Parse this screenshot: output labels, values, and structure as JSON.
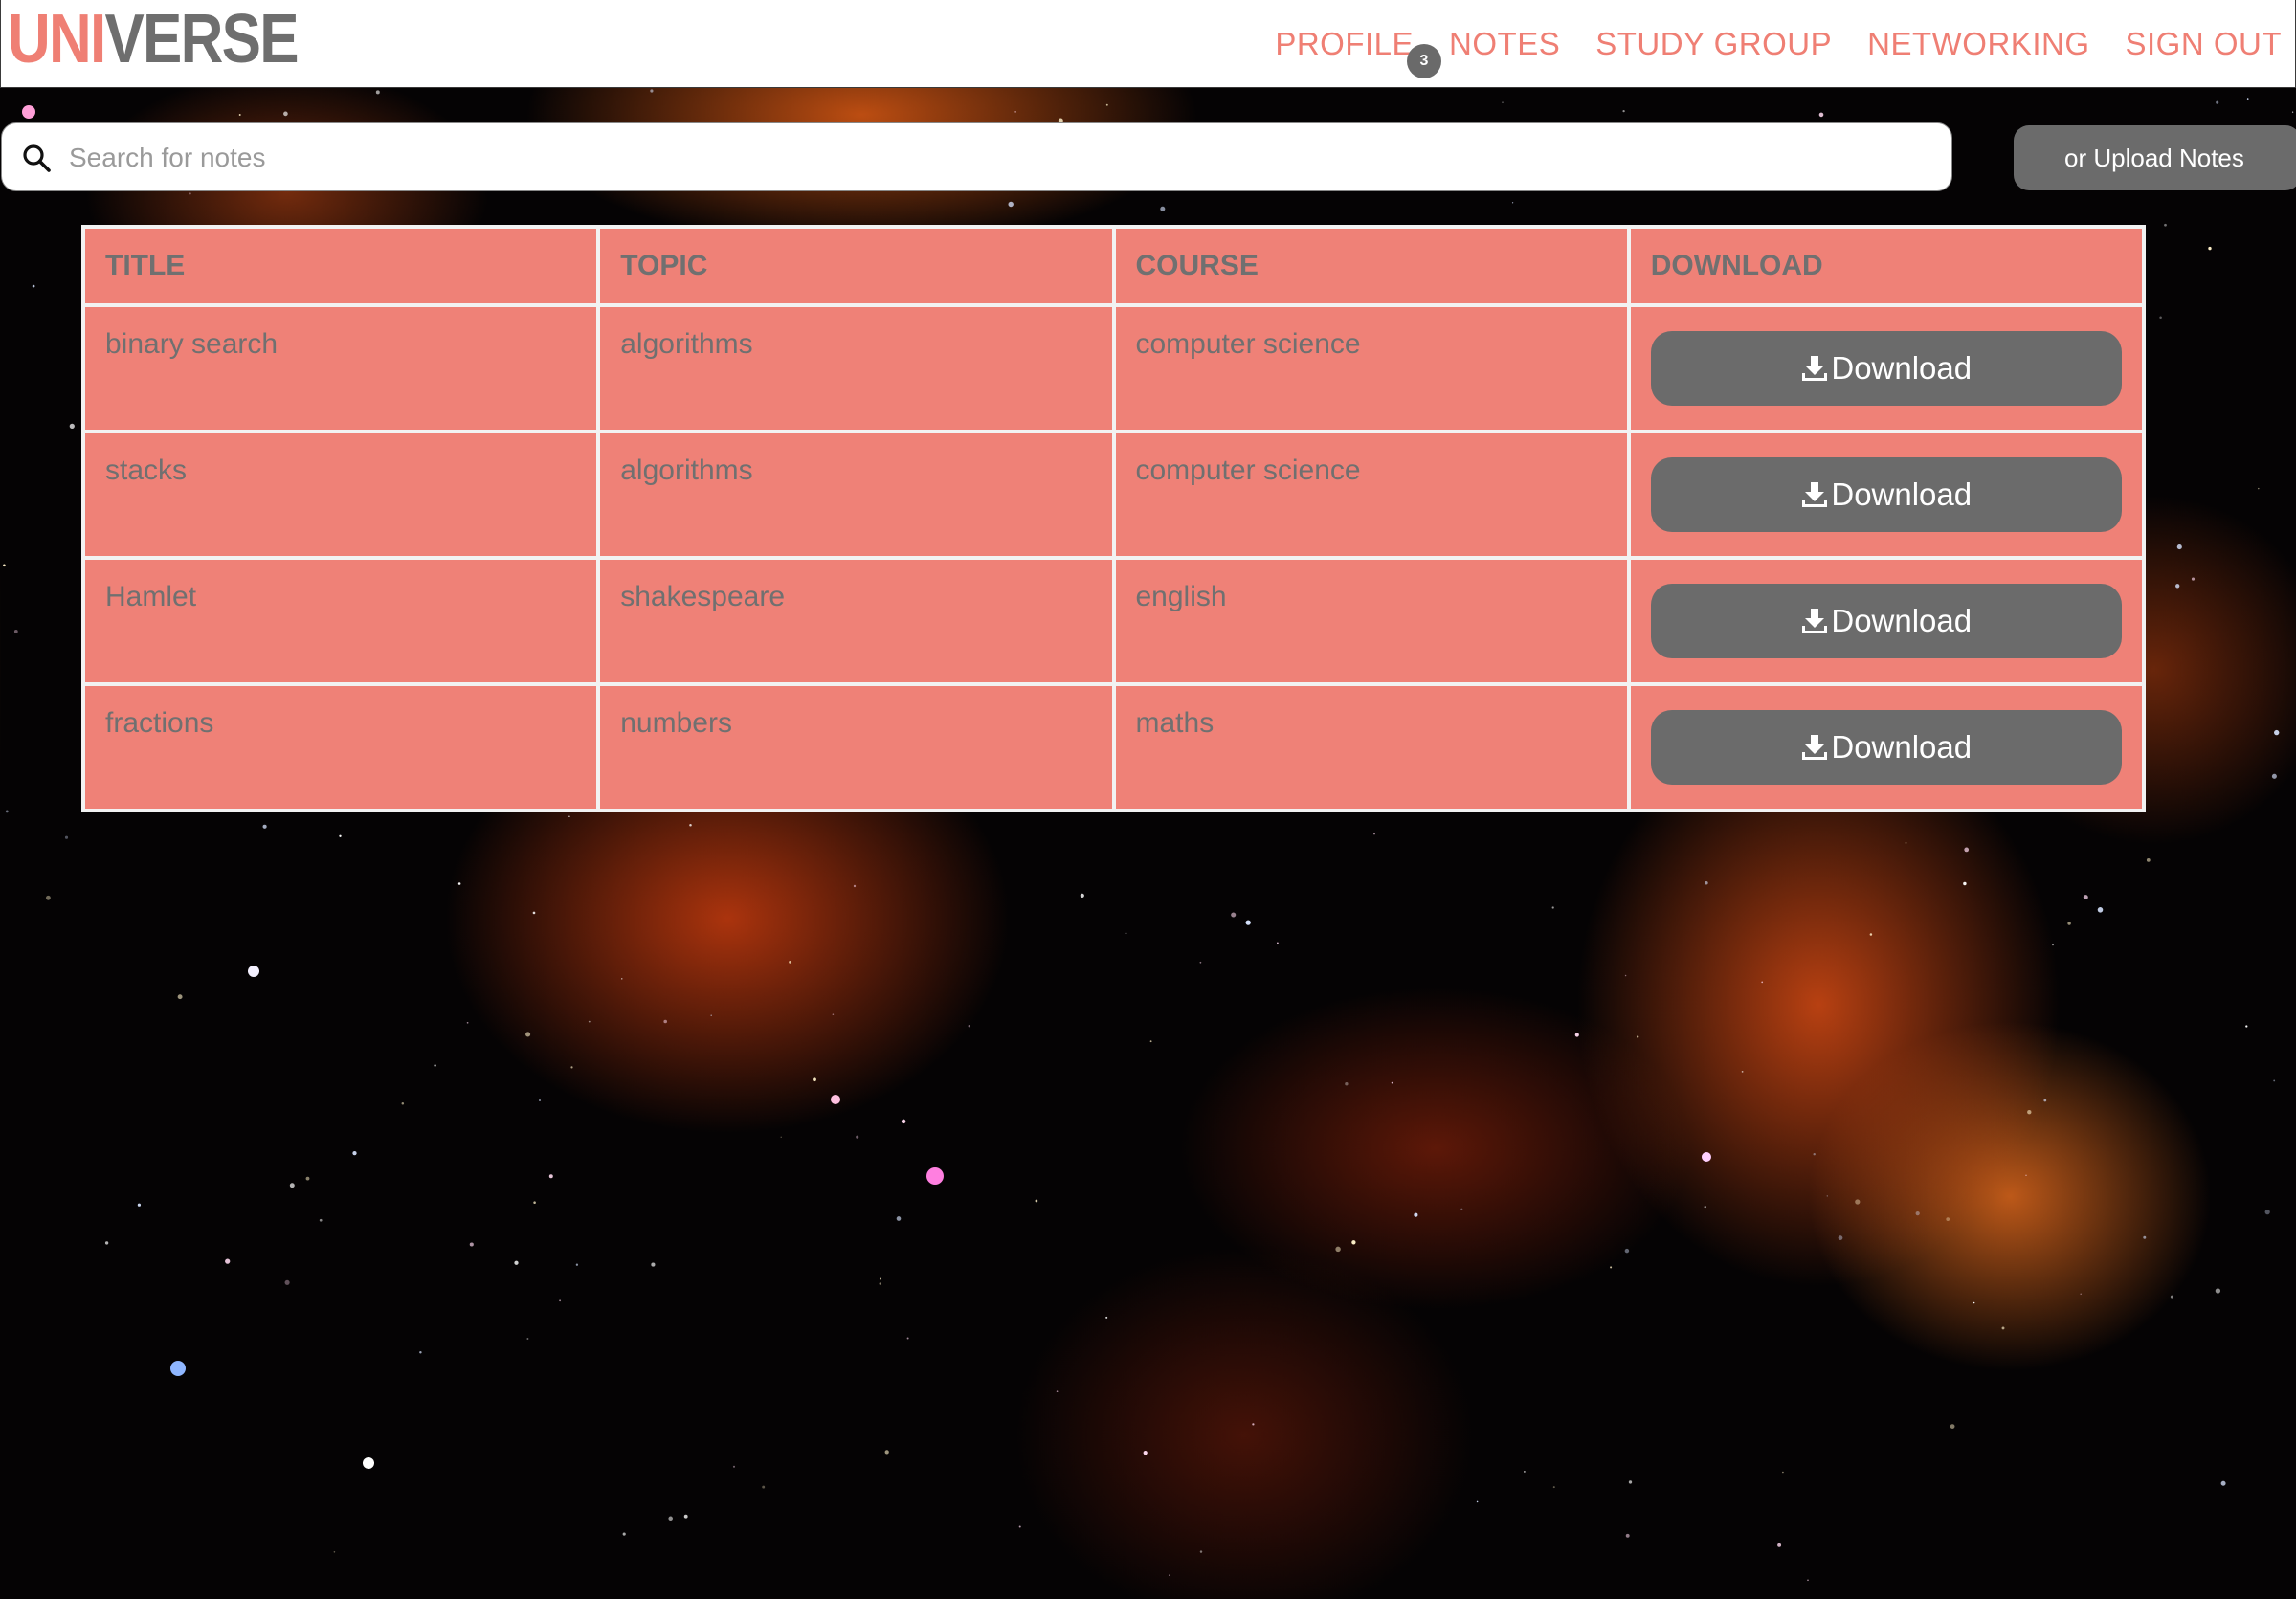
{
  "brand": {
    "part1": "UNI",
    "part2": "VERSE"
  },
  "nav": {
    "items": [
      {
        "id": "profile",
        "label": "PROFILE"
      },
      {
        "id": "notes",
        "label": "NOTES"
      },
      {
        "id": "study_group",
        "label": "STUDY GROUP"
      },
      {
        "id": "networking",
        "label": "NETWORKING"
      },
      {
        "id": "sign_out",
        "label": "SIGN OUT"
      }
    ],
    "profile_badge": "3"
  },
  "search": {
    "placeholder": "Search for notes",
    "value": "",
    "icon": "search-icon"
  },
  "upload_button": {
    "label": "or Upload Notes"
  },
  "table": {
    "headers": [
      "TITLE",
      "TOPIC",
      "COURSE",
      "DOWNLOAD"
    ],
    "rows": [
      {
        "title": "binary search",
        "topic": "algorithms",
        "course": "computer science",
        "download": "Download"
      },
      {
        "title": "stacks",
        "topic": "algorithms",
        "course": "computer science",
        "download": "Download"
      },
      {
        "title": "Hamlet",
        "topic": "shakespeare",
        "course": "english",
        "download": "Download"
      },
      {
        "title": "fractions",
        "topic": "numbers",
        "course": "maths",
        "download": "Download"
      }
    ],
    "download_icon": "download-icon"
  },
  "colors": {
    "accent": "#ef7f74",
    "cell_background": "#ef8177",
    "button_gray": "#6b6b6b",
    "text_gray": "#707070"
  }
}
